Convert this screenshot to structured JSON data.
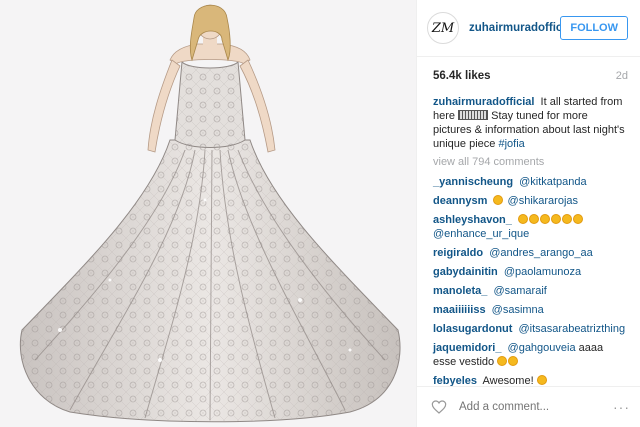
{
  "post": {
    "avatar_text": "ZM",
    "username": "zuhairmuradofficial",
    "follow_label": "FOLLOW",
    "likes": "56.4k likes",
    "age": "2d",
    "caption": {
      "user": "zuhairmuradofficial",
      "text_before": "It all started from here",
      "text_after": "Stay tuned for more pictures & information about last night's unique piece",
      "hashtag": "#jofia"
    },
    "view_all": "view all 794 comments",
    "comments": [
      {
        "user": "_yannischeung",
        "mention": "@kitkatpanda",
        "text": ""
      },
      {
        "user": "deannysm",
        "mention": "@shikararojas",
        "text": ""
      },
      {
        "user": "ashleyshavon_",
        "mention": "@enhance_ur_ique",
        "text": ""
      },
      {
        "user": "reigiraldo",
        "mention": "@andres_arango_aa",
        "text": ""
      },
      {
        "user": "gabydainitin",
        "mention": "@paolamunoza",
        "text": ""
      },
      {
        "user": "manoleta_",
        "mention": "@samaraif",
        "text": ""
      },
      {
        "user": "maaiiiiiiss",
        "mention": "@sasimna",
        "text": ""
      },
      {
        "user": "lolasugardonut",
        "mention": "@itsasarabeatrizthing",
        "text": ""
      },
      {
        "user": "jaquemidori_",
        "mention": "@gahgouveia",
        "text": "aaaa esse vestido"
      },
      {
        "user": "febyeles",
        "mention": "",
        "text": "Awesome!"
      }
    ],
    "add_comment_placeholder": "Add a comment...",
    "more_label": "···"
  },
  "colors": {
    "link": "#125688",
    "follow": "#3897f0",
    "muted": "#a5a7aa"
  }
}
